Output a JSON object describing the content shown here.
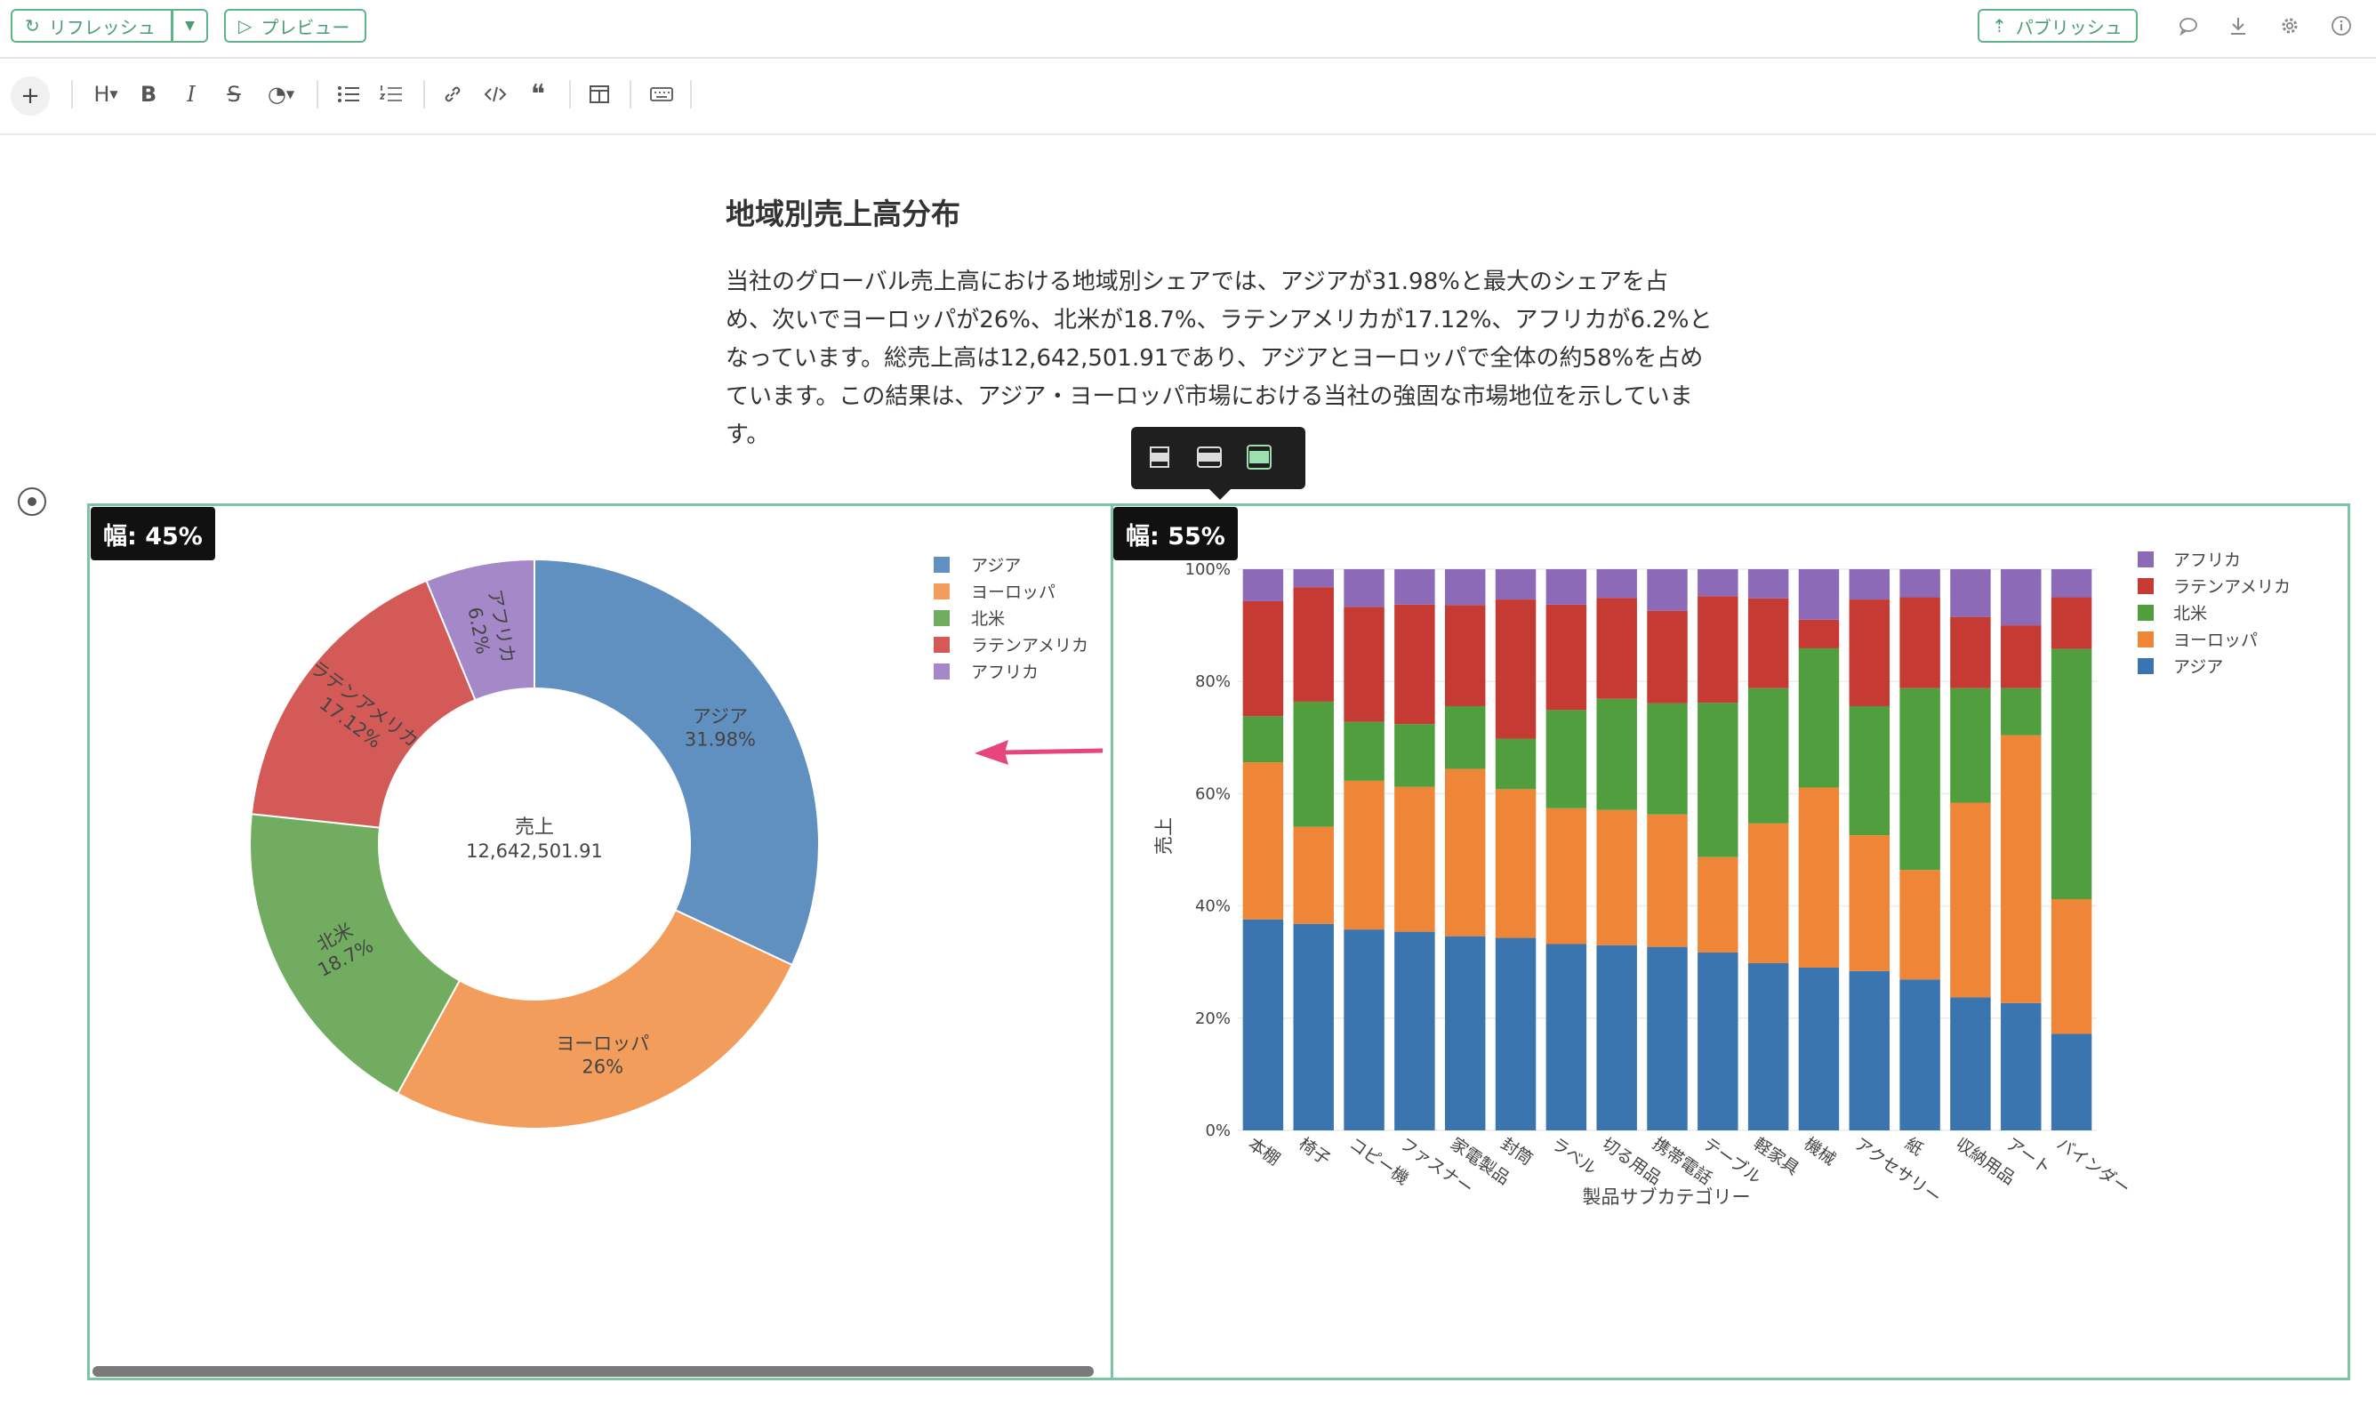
{
  "topbar": {
    "refresh_label": "リフレッシュ",
    "preview_label": "プレビュー",
    "publish_label": "パブリッシュ"
  },
  "toolbar": {
    "add_icon": "plus",
    "heading_label": "H",
    "bold_label": "B",
    "italic_label": "I",
    "strike_label": "S"
  },
  "document": {
    "title": "地域別売上高分布",
    "paragraph": "当社のグローバル売上高における地域別シェアでは、アジアが31.98%と最大のシェアを占め、次いでヨーロッパが26%、北米が18.7%、ラテンアメリカが17.12%、アフリカが6.2%となっています。総売上高は12,642,501.91であり、アジアとヨーロッパで全体の約58%を占めています。この結果は、アジア・ヨーロッパ市場における当社の強固な市場地位を示しています。"
  },
  "panels": {
    "left_width_label": "幅: 45%",
    "right_width_label": "幅: 55%"
  },
  "colors": {
    "accent": "#5fb38a",
    "asia": "#3a75af",
    "europe": "#ef8536",
    "north_america": "#519e3e",
    "latin_america": "#c53a32",
    "africa": "#8d6ab8",
    "arrow": "#e8457a"
  },
  "chart_data": [
    {
      "type": "pie",
      "hole_label": "売上",
      "hole_value": "12,642,501.91",
      "categories": [
        "アジア",
        "ヨーロッパ",
        "北米",
        "ラテンアメリカ",
        "アフリカ"
      ],
      "values": [
        31.98,
        26,
        18.7,
        17.12,
        6.2
      ],
      "value_labels": [
        "31.98%",
        "26%",
        "18.7%",
        "17.12%",
        "6.2%"
      ],
      "colors": [
        "#6090c0",
        "#f29d5c",
        "#72ac61",
        "#d35a56",
        "#a488c8"
      ],
      "legend_position": "top-right"
    },
    {
      "type": "bar",
      "stacked": "percent",
      "xlabel": "製品サブカテゴリー",
      "ylabel": "売上",
      "ytick_labels": [
        "0%",
        "20%",
        "40%",
        "60%",
        "80%",
        "100%"
      ],
      "ylim": [
        0,
        100
      ],
      "categories": [
        "本棚",
        "椅子",
        "コピー機",
        "ファスナー",
        "家電製品",
        "封筒",
        "ラベル",
        "切る用品",
        "携帯電話",
        "テーブル",
        "軽家具",
        "機械",
        "アクセサリー",
        "紙",
        "収納用品",
        "アート",
        "バインダー"
      ],
      "legend_position": "top-right",
      "legend_order": [
        "アフリカ",
        "ラテンアメリカ",
        "北米",
        "ヨーロッパ",
        "アジア"
      ],
      "series": [
        {
          "name": "アジア",
          "color": "#3a75af",
          "values": [
            37.6,
            36.8,
            35.8,
            35.4,
            34.6,
            34.3,
            33.2,
            33.0,
            32.7,
            31.7,
            29.8,
            29.0,
            28.4,
            26.9,
            23.7,
            22.7,
            17.2
          ]
        },
        {
          "name": "ヨーロッパ",
          "color": "#ef8536",
          "values": [
            28.0,
            17.3,
            26.5,
            25.8,
            29.8,
            26.5,
            24.2,
            24.1,
            23.6,
            17.0,
            24.9,
            32.1,
            24.2,
            19.5,
            34.7,
            47.7,
            24.0
          ]
        },
        {
          "name": "北米",
          "color": "#519e3e",
          "values": [
            8.2,
            22.3,
            10.5,
            11.2,
            11.2,
            9.0,
            17.5,
            19.8,
            19.8,
            27.5,
            24.1,
            24.8,
            23.0,
            32.4,
            20.4,
            8.4,
            44.6
          ]
        },
        {
          "name": "ラテンアメリカ",
          "color": "#c53a32",
          "values": [
            20.5,
            20.4,
            20.5,
            21.3,
            18.0,
            24.8,
            18.8,
            18.0,
            16.5,
            19.0,
            16.0,
            5.1,
            19.0,
            16.2,
            12.7,
            11.2,
            9.2
          ]
        },
        {
          "name": "アフリカ",
          "color": "#8d6ab8",
          "values": [
            5.7,
            3.2,
            6.7,
            6.3,
            6.4,
            5.4,
            6.3,
            5.1,
            7.4,
            4.8,
            5.2,
            9.0,
            5.4,
            5.0,
            8.5,
            10.0,
            5.0
          ]
        }
      ]
    }
  ]
}
